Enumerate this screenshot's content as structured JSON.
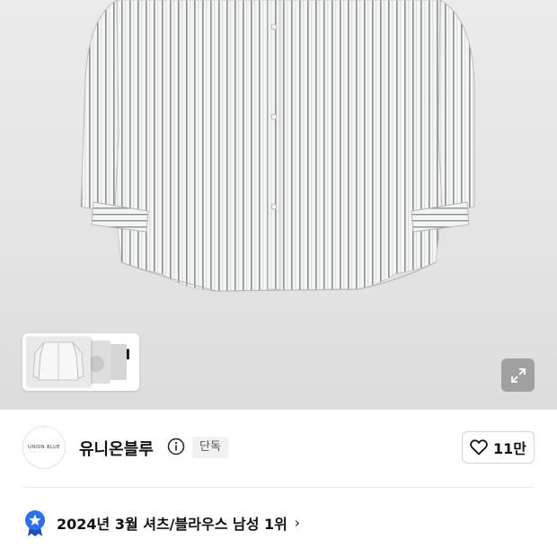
{
  "hero": {
    "image_alt": "striped oxford shirt product photo",
    "thumbnail_strip": {
      "ai_label": "AI",
      "chevron": "›"
    },
    "expand_icon": "expand-arrows-icon"
  },
  "brand": {
    "logo_text": "UNION BLUE",
    "name": "유니온블루",
    "info_icon": "info-circle-icon",
    "badge": "단독"
  },
  "like": {
    "icon": "heart-outline-icon",
    "count": "11만"
  },
  "ranking": {
    "icon": "medal-star-icon",
    "text": "2024년 3월 셔츠/블라우스 남성 1위",
    "chevron": "›",
    "medal_color": "#2f6fe8"
  }
}
